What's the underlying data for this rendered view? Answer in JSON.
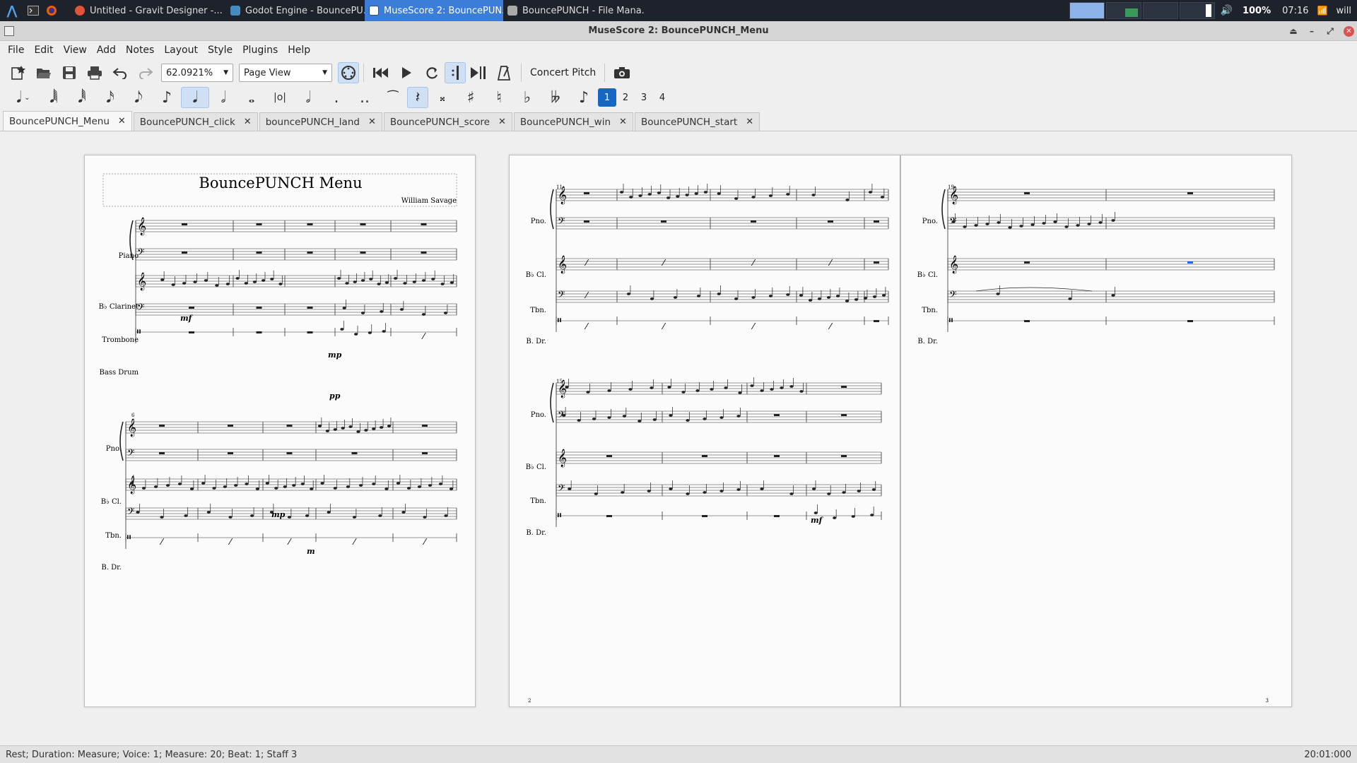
{
  "taskbar": {
    "tasks": [
      {
        "label": "Untitled - Gravit Designer -...",
        "icon": "gravit-icon",
        "color": "#e0543b"
      },
      {
        "label": "Godot Engine - BouncePU...",
        "icon": "godot-icon",
        "color": "#478cbf"
      },
      {
        "label": "MuseScore 2: BouncePUN...",
        "icon": "musescore-icon",
        "color": "#ffffff"
      },
      {
        "label": "BouncePUNCH - File Mana...",
        "icon": "folder-icon",
        "color": "#aaaaaa"
      }
    ],
    "volume": "100%",
    "time": "07:16",
    "user": "will"
  },
  "window": {
    "title": "MuseScore 2: BouncePUNCH_Menu"
  },
  "menus": [
    "File",
    "Edit",
    "View",
    "Add",
    "Notes",
    "Layout",
    "Style",
    "Plugins",
    "Help"
  ],
  "toolbar": {
    "zoom": "62.0921%",
    "view_mode": "Page View",
    "concert_pitch": "Concert Pitch",
    "voices": [
      "1",
      "2",
      "3",
      "4"
    ]
  },
  "tabs": [
    {
      "label": "BouncePUNCH_Menu",
      "active": true
    },
    {
      "label": "BouncePUNCH_click",
      "active": false
    },
    {
      "label": "bouncePUNCH_land",
      "active": false
    },
    {
      "label": "BouncePUNCH_score",
      "active": false
    },
    {
      "label": "BouncePUNCH_win",
      "active": false
    },
    {
      "label": "BouncePUNCH_start",
      "active": false
    }
  ],
  "score": {
    "title": "BouncePUNCH Menu",
    "composer": "William Savage",
    "page1_instruments": [
      "Piano",
      "B♭ Clarinet",
      "Trombone",
      "Bass Drum"
    ],
    "short_instruments": [
      "Pno.",
      "B♭ Cl.",
      "Tbn.",
      "B. Dr."
    ],
    "dynamics": {
      "mf": "mf",
      "mp": "mp",
      "pp": "pp",
      "m": "m"
    },
    "measure_numbers": {
      "sys2": "6",
      "p2sys1": "11",
      "p2sys2": "15",
      "p3sys1": "19"
    },
    "page_numbers": {
      "p2": "2",
      "p3": "3"
    }
  },
  "status": {
    "left": "Rest; Duration: Measure; Voice: 1;  Measure: 20; Beat: 1; Staff 3",
    "right": "20:01:000"
  }
}
